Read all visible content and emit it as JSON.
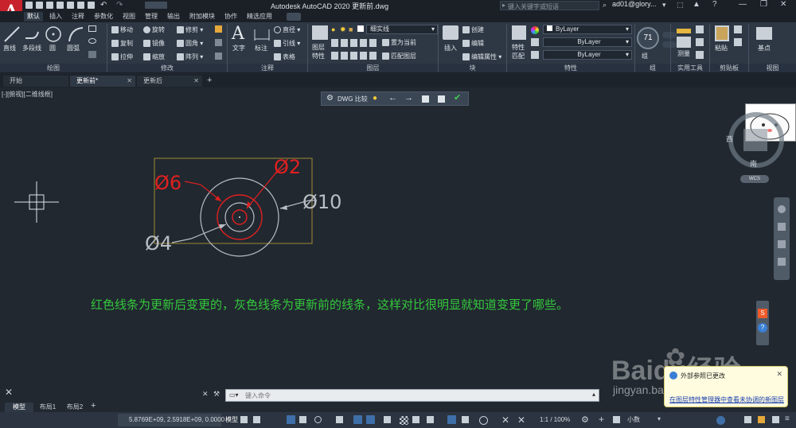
{
  "app": {
    "title": "Autodesk AutoCAD 2020    更新前.dwg",
    "search_placeholder": "键入关键字或短语",
    "user": "ad01@glory...",
    "logo": "A"
  },
  "ribbon_tabs": [
    "默认",
    "插入",
    "注释",
    "参数化",
    "视图",
    "管理",
    "输出",
    "附加模块",
    "协作",
    "精选应用"
  ],
  "ribbon": {
    "draw": {
      "line": "直线",
      "polyline": "多段线",
      "circle": "圆",
      "arc": "圆弧",
      "label": "绘图"
    },
    "modify": {
      "move": "移动",
      "rotate": "旋转",
      "trim": "修剪",
      "copy": "复制",
      "mirror": "镜像",
      "fillet": "圆角",
      "stretch": "拉伸",
      "scale": "缩放",
      "array": "阵列",
      "label": "修改"
    },
    "annotation": {
      "text": "文字",
      "dim": "标注",
      "linear": "直径",
      "leader": "引线",
      "table": "表格",
      "label": "注释"
    },
    "layers": {
      "props": "图层\n特性",
      "current_layer": "细实线",
      "set_current": "置为当前",
      "match": "匹配图层",
      "label": "图层"
    },
    "block": {
      "insert": "插入",
      "create": "创建",
      "edit": "编辑",
      "edit_attr": "编辑属性",
      "label": "块"
    },
    "properties": {
      "match": "特性\n匹配",
      "color": "ByLayer",
      "linetype": "ByLayer",
      "lineweight": "ByLayer",
      "label": "特性"
    },
    "groups": {
      "group": "组",
      "label": "组"
    },
    "utilities": {
      "measure": "测量",
      "label": "实用工具"
    },
    "clipboard": {
      "paste": "粘贴",
      "label": "剪贴板"
    },
    "view": {
      "base": "基点",
      "label": "视图"
    },
    "percent": "71"
  },
  "doc_tabs": [
    {
      "label": "开始"
    },
    {
      "label": "更新前*"
    },
    {
      "label": "更新后"
    }
  ],
  "viewport": {
    "label": "[-][俯视][二维线框]",
    "compare_label": "DWG 比较",
    "viewcube": {
      "west": "西",
      "south": "南",
      "wcs": "WCS"
    },
    "drawing": {
      "d6": "Ø6",
      "d2": "Ø2",
      "d10": "Ø10",
      "d4": "Ø4"
    },
    "annotation": "红色线条为更新后变更的，灰色线条为更新前的线条，这样对比很明显就知道变更了哪些。"
  },
  "command": {
    "placeholder": "键入命令"
  },
  "layout_tabs": [
    "模型",
    "布局1",
    "布局2"
  ],
  "status": {
    "coords": "5.8769E+09, 2.5918E+09, 0.0000",
    "mode": "模型",
    "scale": "1:1 / 100%",
    "units": "小数"
  },
  "notification": {
    "title": "外部参照已更改",
    "link": "在图层特性管理器中查看未协调的新图层"
  },
  "watermark": {
    "text": "Baidu经验",
    "url": "jingyan.baidu.com"
  },
  "colors": {
    "background": "#212830",
    "ribbon": "#2e3845",
    "red_lines": "#e02020",
    "gray_lines": "#b8bec4",
    "rectangle": "#a08a30",
    "annotation": "#34c83c"
  }
}
